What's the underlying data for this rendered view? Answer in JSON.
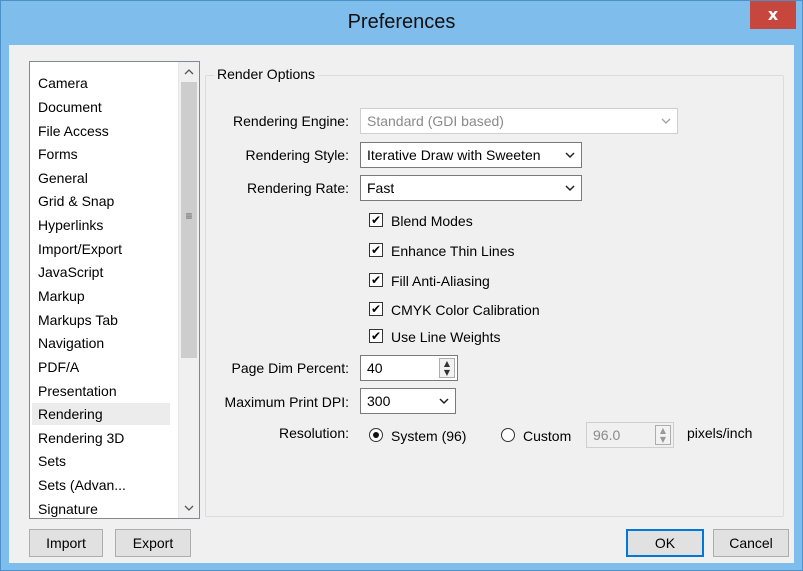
{
  "window": {
    "title": "Preferences",
    "close_glyph": "x"
  },
  "sidebar": {
    "items": [
      {
        "label": "Camera"
      },
      {
        "label": "Document"
      },
      {
        "label": "File Access"
      },
      {
        "label": "Forms"
      },
      {
        "label": "General"
      },
      {
        "label": "Grid & Snap"
      },
      {
        "label": "Hyperlinks"
      },
      {
        "label": "Import/Export"
      },
      {
        "label": "JavaScript"
      },
      {
        "label": "Markup"
      },
      {
        "label": "Markups Tab"
      },
      {
        "label": "Navigation"
      },
      {
        "label": "PDF/A"
      },
      {
        "label": "Presentation"
      },
      {
        "label": "Rendering"
      },
      {
        "label": "Rendering 3D"
      },
      {
        "label": "Sets"
      },
      {
        "label": "Sets (Advan..."
      },
      {
        "label": "Signature"
      }
    ],
    "selected": "Rendering",
    "import_label": "Import",
    "export_label": "Export"
  },
  "render": {
    "group_title": "Render Options",
    "engine_label": "Rendering Engine:",
    "engine_value": "Standard (GDI based)",
    "style_label": "Rendering Style:",
    "style_value": "Iterative Draw with Sweeten",
    "rate_label": "Rendering Rate:",
    "rate_value": "Fast",
    "checks": [
      {
        "label": "Blend Modes",
        "checked": true
      },
      {
        "label": "Enhance Thin Lines",
        "checked": true
      },
      {
        "label": "Fill Anti-Aliasing",
        "checked": true
      },
      {
        "label": "CMYK Color Calibration",
        "checked": true
      },
      {
        "label": "Use Line Weights",
        "checked": true
      }
    ],
    "page_dim_label": "Page Dim Percent:",
    "page_dim_value": "40",
    "max_dpi_label": "Maximum Print DPI:",
    "max_dpi_value": "300",
    "resolution_label": "Resolution:",
    "system_label": "System (96)",
    "custom_label": "Custom",
    "custom_value": "96.0",
    "units_label": "pixels/inch",
    "resolution_selected": "System (96)"
  },
  "footer": {
    "ok_label": "OK",
    "cancel_label": "Cancel"
  },
  "glyphs": {
    "check": "✔",
    "chevron": "⌄",
    "up": "▲",
    "down": "▼",
    "grip": "≡"
  }
}
